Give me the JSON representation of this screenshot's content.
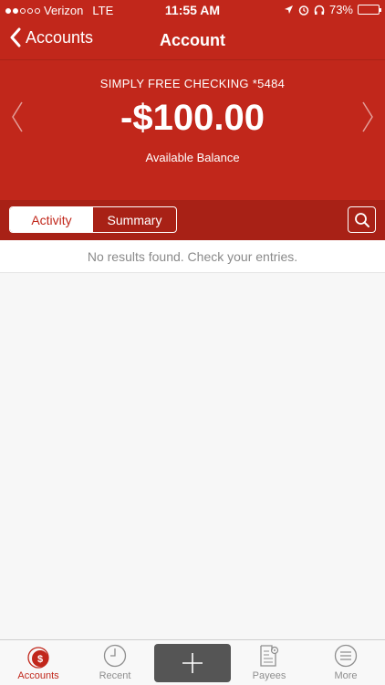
{
  "status_bar": {
    "carrier": "Verizon",
    "network": "LTE",
    "time": "11:55 AM",
    "battery": "73%",
    "battery_level": 0.73
  },
  "nav": {
    "back_label": "Accounts",
    "title": "Account"
  },
  "account": {
    "name": "SIMPLY FREE CHECKING *5484",
    "balance": "-$100.00",
    "balance_label": "Available Balance"
  },
  "segments": {
    "activity": "Activity",
    "summary": "Summary"
  },
  "results": {
    "empty_message": "No results found. Check your entries."
  },
  "tabbar": {
    "accounts": "Accounts",
    "recent": "Recent",
    "payees": "Payees",
    "more": "More"
  },
  "colors": {
    "brand": "#c1271b",
    "brand_dark": "#a82116"
  }
}
